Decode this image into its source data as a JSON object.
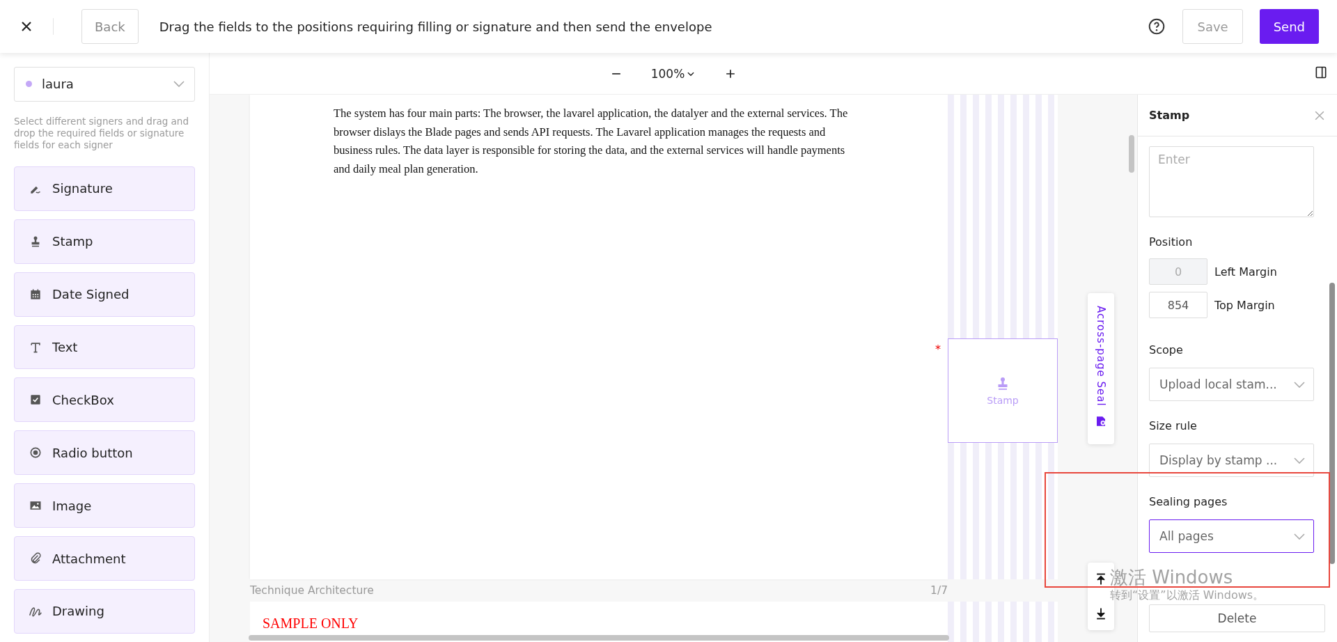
{
  "top_bar": {
    "back_button": "Back",
    "title": "Drag the fields to the positions requiring filling or signature and then send the envelope",
    "save_button": "Save",
    "send_button": "Send"
  },
  "sidebar": {
    "signer": {
      "name": "laura",
      "color": "#c4a8f7"
    },
    "hint": "Select different signers and drag and drop the required fields or signature fields for each signer",
    "fields": [
      {
        "label": "Signature",
        "kind": "signature"
      },
      {
        "label": "Stamp",
        "kind": "stamp"
      },
      {
        "label": "Date Signed",
        "kind": "date"
      },
      {
        "label": "Text",
        "kind": "text"
      },
      {
        "label": "CheckBox",
        "kind": "checkbox"
      },
      {
        "label": "Radio button",
        "kind": "radio"
      },
      {
        "label": "Image",
        "kind": "image"
      },
      {
        "label": "Attachment",
        "kind": "attachment"
      },
      {
        "label": "Drawing",
        "kind": "drawing"
      }
    ]
  },
  "toolbar": {
    "zoom": "100%"
  },
  "document": {
    "paragraph": "The system has four main parts: The browser, the lavarel application, the datalyer and the external services. The browser dislays the Blade pages and sends API requests. The Lavarel application manages the requests and business rules. The data layer is responsible for storing the data, and the external services will handle payments and daily meal plan generation.",
    "stamp_field": {
      "label": "Stamp",
      "required_mark": "*"
    },
    "across_page_seal": "Across-page Seal",
    "page_title": "Technique Architecture",
    "page_number": "1/7",
    "next_page_text": "SAMPLE ONLY"
  },
  "panel": {
    "title": "Stamp",
    "note": {
      "placeholder": "Enter"
    },
    "position": {
      "label": "Position",
      "fields": [
        {
          "value": "0",
          "label": "Left Margin",
          "disabled": true
        },
        {
          "value": "854",
          "label": "Top Margin",
          "disabled": false
        }
      ]
    },
    "selects": [
      {
        "label": "Scope",
        "value": "Upload local stam...",
        "focused": false
      },
      {
        "label": "Size rule",
        "value": "Display by stamp ...",
        "focused": false
      },
      {
        "label": "Sealing pages",
        "value": "All pages",
        "focused": true
      }
    ],
    "delete_button": "Delete"
  },
  "os_watermark": {
    "title": "激活 Windows",
    "subtitle": "转到“设置”以激活 Windows。"
  }
}
